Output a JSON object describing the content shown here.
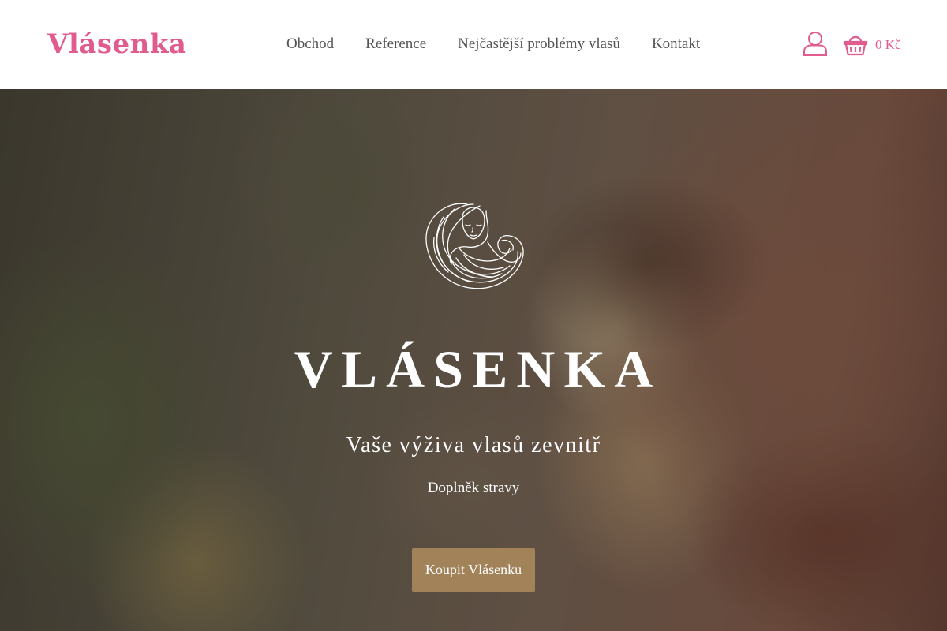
{
  "header": {
    "logo": "Vlásenka",
    "nav": [
      {
        "label": "Obchod"
      },
      {
        "label": "Reference"
      },
      {
        "label": "Nejčastější problémy vlasů"
      },
      {
        "label": "Kontakt"
      }
    ],
    "account_icon": "user-icon",
    "cart_icon": "basket-icon",
    "cart_total": "0 Kč"
  },
  "hero": {
    "emblem_icon": "woman-with-flowing-hair-emblem",
    "title": "VLÁSENKA",
    "subtitle": "Vaše výživa vlasů zevnitř",
    "tagline": "Doplněk stravy",
    "cta_label": "Koupit Vlásenku"
  },
  "colors": {
    "brand_pink": "#e05c8f",
    "cta_brown": "#a18259",
    "nav_text": "#555555"
  }
}
